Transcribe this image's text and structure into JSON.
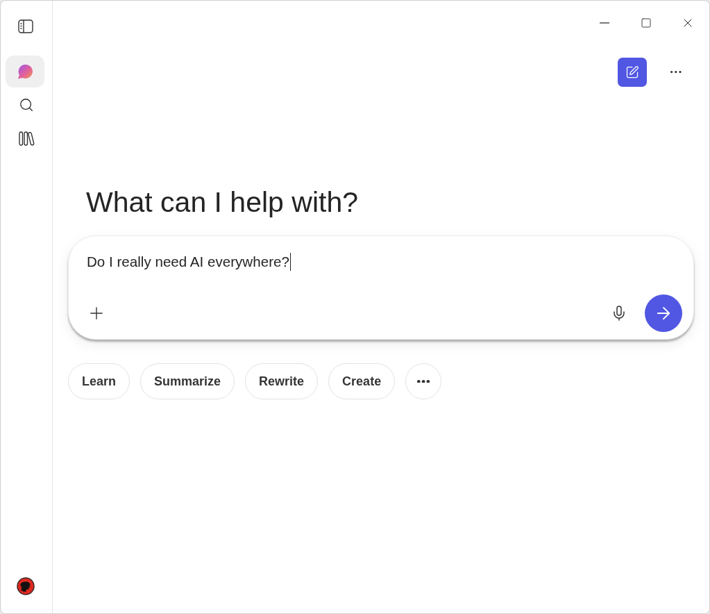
{
  "sidebar": {
    "items": [
      {
        "kind": "chat",
        "selected": true
      },
      {
        "kind": "search",
        "selected": false
      },
      {
        "kind": "library",
        "selected": false
      }
    ]
  },
  "heading": "What can I help with?",
  "composer": {
    "value": "Do I really need AI everywhere?",
    "focused": true
  },
  "suggestions": [
    "Learn",
    "Summarize",
    "Rewrite",
    "Create"
  ]
}
